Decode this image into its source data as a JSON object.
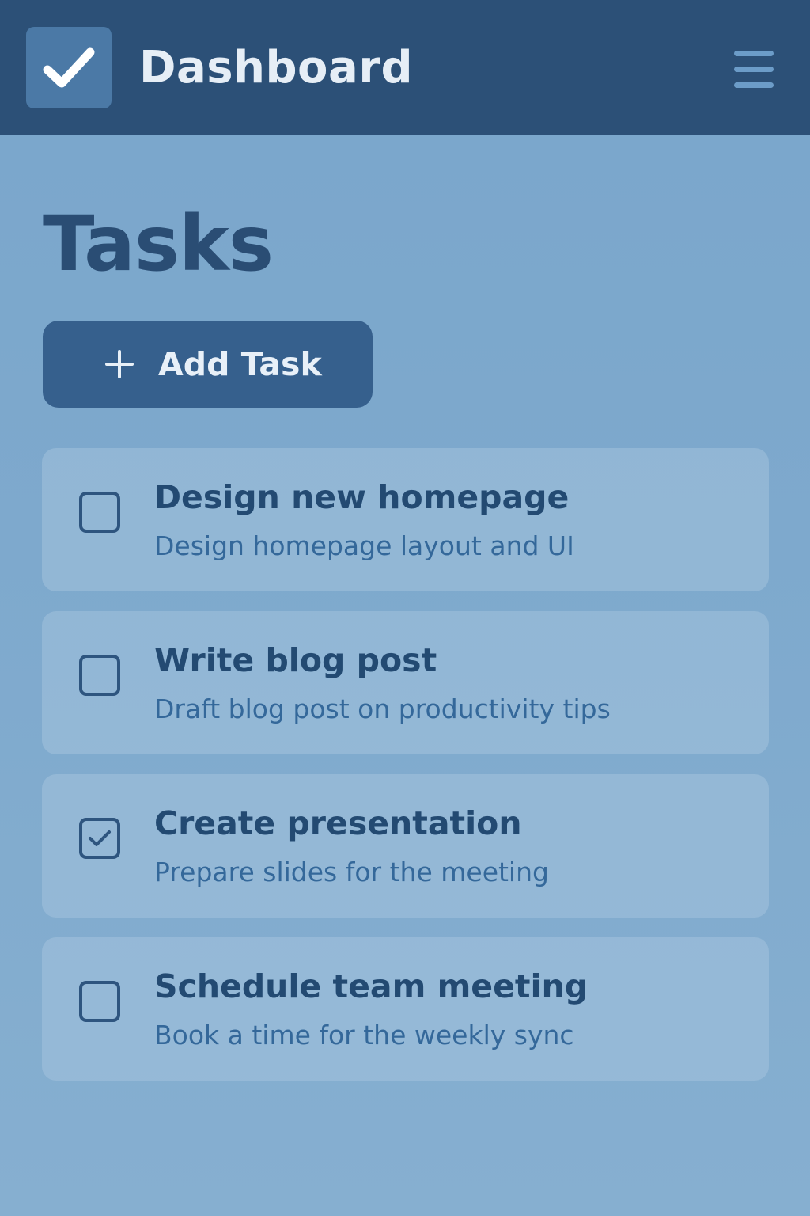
{
  "header": {
    "title": "Dashboard",
    "logo_icon": "checkmark-icon",
    "menu_icon": "hamburger-menu-icon"
  },
  "main": {
    "title": "Tasks",
    "add_button": {
      "label": "Add Task",
      "icon": "plus-icon"
    },
    "tasks": [
      {
        "title": "Design new homepage",
        "description": "Design homepage layout and UI",
        "checked": false
      },
      {
        "title": "Write blog post",
        "description": "Draft blog post on productivity tips",
        "checked": false
      },
      {
        "title": "Create presentation",
        "description": "Prepare slides for the meeting",
        "checked": true
      },
      {
        "title": "Schedule team meeting",
        "description": "Book a time for the weekly sync",
        "checked": false
      }
    ]
  },
  "colors": {
    "header_bg": "#2c5077",
    "page_bg": "#7ea9cd",
    "accent": "#36608d",
    "text_dark": "#234a72",
    "text_light": "#34689a"
  }
}
